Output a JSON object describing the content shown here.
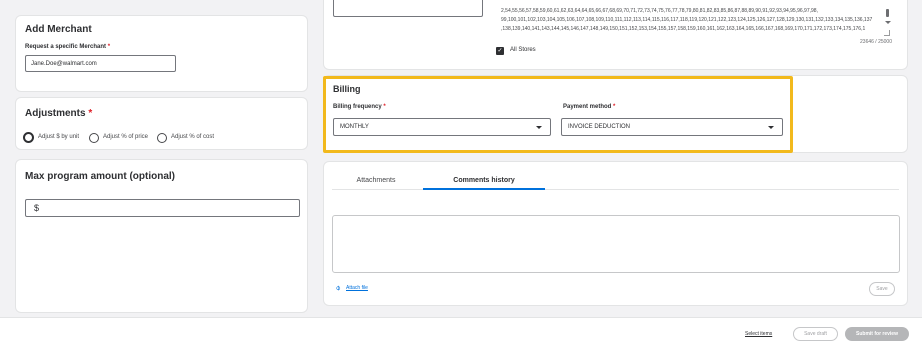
{
  "add_merchant": {
    "title": "Add Merchant",
    "request_label": "Request a specific Merchant",
    "request_value": "Jane.Doe@walmart.com"
  },
  "adjustments": {
    "title": "Adjustments",
    "options": [
      "Adjust $ by unit",
      "Adjust % of price",
      "Adjust % of cost"
    ]
  },
  "max_program": {
    "title": "Max program amount (optional)",
    "currency_symbol": "$"
  },
  "stores": {
    "line1": "2,54,55,56,57,58,59,60,61,62,63,64,64,65,66,67,68,69,70,71,72,73,74,75,76,77,78,79,80,81,82,83,85,86,87,88,89,90,91,92,93,94,95,96,97,98,",
    "line2": "99,100,101,102,103,104,105,106,107,108,109,110,111,112,113,114,115,116,117,118,119,120,121,122,123,124,125,126,127,128,129,130,131,132,133,134,135,136,137",
    "line3": ",138,139,140,141,143,144,145,146,147,148,149,150,151,152,153,154,155,157,158,159,160,161,162,163,164,165,166,167,168,169,170,171,172,173,174,175,176,1",
    "char_count": "23646 / 25000",
    "all_stores_label": "All Stores"
  },
  "billing": {
    "title": "Billing",
    "frequency_label": "Billing frequency",
    "frequency_value": "MONTHLY",
    "payment_label": "Payment method",
    "payment_value": "INVOICE DEDUCTION"
  },
  "comments": {
    "tabs": [
      "Attachments",
      "Comments history"
    ],
    "active_tab_index": 1,
    "attach_label": "Attach file",
    "save_label": "Save"
  },
  "footer": {
    "select_items": "Select items",
    "save_draft": "Save draft",
    "submit": "Submit for review"
  },
  "colors": {
    "highlight": "#f2b91c",
    "tab_underline": "#0071dc",
    "link_blue": "#0071dc"
  }
}
